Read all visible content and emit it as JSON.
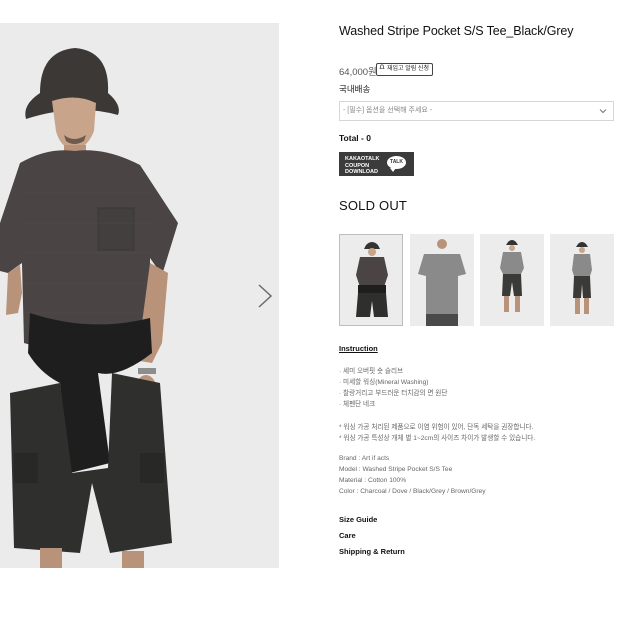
{
  "product": {
    "title": "Washed Stripe Pocket S/S Tee_Black/Grey",
    "price": "64,000원",
    "restock_button": "재입고 알림 신청",
    "shipping_label": "국내배송",
    "option_placeholder": "- [필수] 옵션을 선택해 주세요 -",
    "total": "Total - 0",
    "kakao_coupon_lines": [
      "KAKAOTALK",
      "COUPON",
      "DOWNLOAD"
    ],
    "kakao_bubble": "TALK",
    "status": "SOLD OUT"
  },
  "details": {
    "instruction_heading": "Instruction",
    "features": [
      "· 세미 오버핏 숏 슬리브",
      "· 미세할 워싱(Mineral Washing)",
      "· 찰랑거리고 부드러운 터치감의 면 원단",
      "· 체펜단 네크"
    ],
    "notes": [
      "* 워싱 가공 처리된 제품으로 이염 위험이 있어, 단독 세탁을 권장합니다.",
      "* 워싱 가공 특성상 개체 별 1~2cm의 사이즈 차이가 발생할 수 있습니다."
    ],
    "specs": [
      "Brand : Art if acts",
      "Model : Washed Stripe Pocket S/S Tee",
      "Material : Cotton 100%",
      "Color : Charcoal / Dove / Black/Grey / Brown/Grey"
    ]
  },
  "links": {
    "size_guide": "Size Guide",
    "care": "Care",
    "shipping_return": "Shipping & Return"
  },
  "colors": {
    "shirt": "#4a4544",
    "shorts": "#2f2f2d",
    "background": "#ececec"
  }
}
